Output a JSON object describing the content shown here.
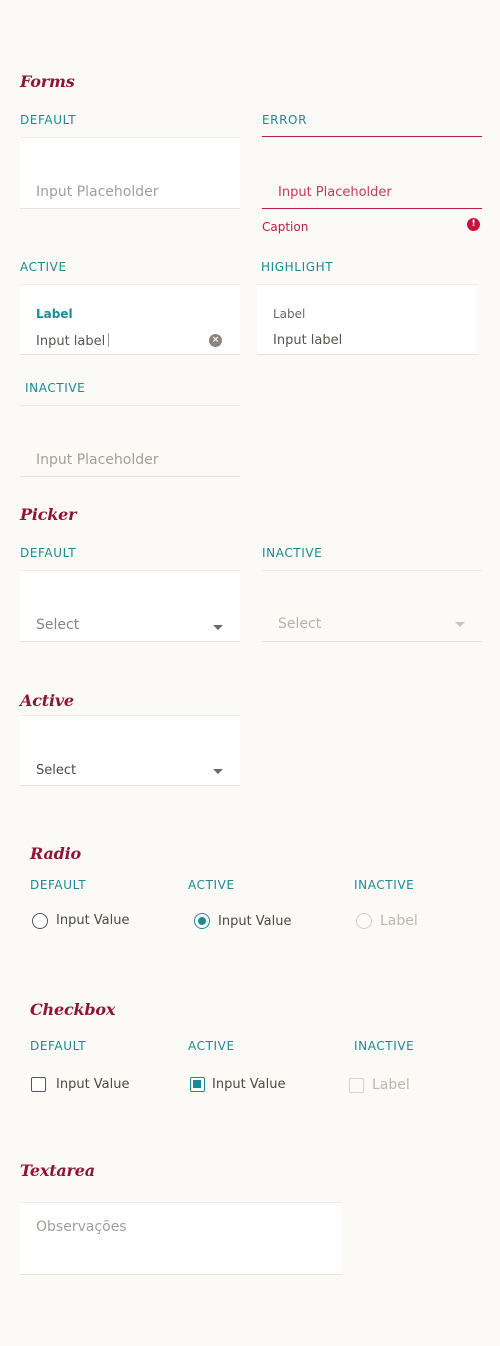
{
  "forms": {
    "title": "Forms",
    "default": {
      "state": "DEFAULT",
      "placeholder": "Input Placeholder"
    },
    "error": {
      "state": "ERROR",
      "placeholder": "Input Placeholder",
      "caption": "Caption",
      "alert_glyph": "!"
    },
    "active": {
      "state": "ACTIVE",
      "label": "Label",
      "value": "Input label",
      "clear_glyph": "×"
    },
    "highlight": {
      "state": "HIGHLIGHT",
      "label": "Label",
      "value": "Input label"
    },
    "inactive": {
      "state": "INACTIVE",
      "placeholder": "Input Placeholder"
    }
  },
  "picker": {
    "title": "Picker",
    "default": {
      "state": "DEFAULT",
      "value": "Select"
    },
    "inactive": {
      "state": "INACTIVE",
      "value": "Select"
    }
  },
  "picker_active": {
    "title": "Active",
    "value": "Select"
  },
  "radio": {
    "title": "Radio",
    "default": {
      "state": "DEFAULT",
      "label": "Input Value"
    },
    "active": {
      "state": "ACTIVE",
      "label": "Input Value"
    },
    "inactive": {
      "state": "INACTIVE",
      "label": "Label"
    }
  },
  "checkbox": {
    "title": "Checkbox",
    "default": {
      "state": "DEFAULT",
      "label": "Input Value"
    },
    "active": {
      "state": "ACTIVE",
      "label": "Input Value"
    },
    "inactive": {
      "state": "INACTIVE",
      "label": "Label"
    }
  },
  "textarea": {
    "title": "Textarea",
    "placeholder": "Observações"
  },
  "colors": {
    "accent_teal": "#1a8a93",
    "brand_wine": "#8e1538",
    "error_red": "#b81c4a",
    "background": "#fcfaf6"
  }
}
